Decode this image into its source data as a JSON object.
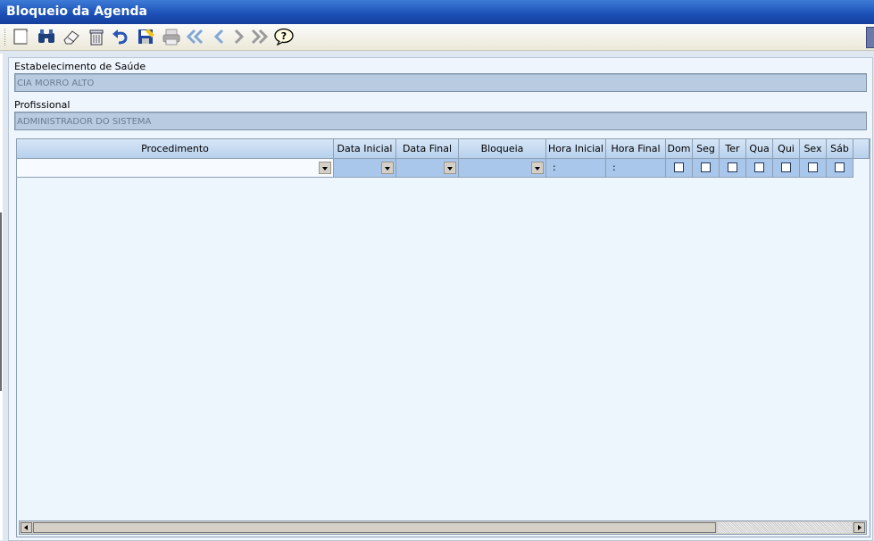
{
  "window": {
    "title": "Bloqueio da Agenda"
  },
  "toolbar": {
    "buttons": [
      {
        "name": "new-button",
        "icon": "new-document-icon"
      },
      {
        "name": "search-button",
        "icon": "binoculars-icon"
      },
      {
        "name": "clear-button",
        "icon": "eraser-icon"
      },
      {
        "name": "delete-button",
        "icon": "trash-icon"
      },
      {
        "name": "undo-button",
        "icon": "undo-icon"
      },
      {
        "name": "save-button",
        "icon": "save-icon"
      },
      {
        "name": "print-button",
        "icon": "printer-icon"
      },
      {
        "name": "first-record-button",
        "icon": "double-chevron-left-icon"
      },
      {
        "name": "previous-record-button",
        "icon": "chevron-left-icon"
      },
      {
        "name": "next-record-button",
        "icon": "chevron-right-icon"
      },
      {
        "name": "last-record-button",
        "icon": "double-chevron-right-icon"
      },
      {
        "name": "help-button",
        "icon": "help-icon"
      }
    ]
  },
  "form": {
    "estabelecimento_label": "Estabelecimento de Saúde",
    "estabelecimento_value": "CIA MORRO ALTO",
    "profissional_label": "Profissional",
    "profissional_value": "ADMINISTRADOR DO SISTEMA"
  },
  "grid": {
    "columns": [
      "Procedimento",
      "Data Inicial",
      "Data Final",
      "Bloqueia",
      "Hora Inicial",
      "Hora Final",
      "Dom",
      "Seg",
      "Ter",
      "Qua",
      "Qui",
      "Sex",
      "Sáb"
    ],
    "row": {
      "hora_inicial": ":",
      "hora_final": ":"
    }
  },
  "colors": {
    "titlebar": "#1a4fb6",
    "header": "#b8d1ec",
    "field": "#b8cbe0"
  }
}
